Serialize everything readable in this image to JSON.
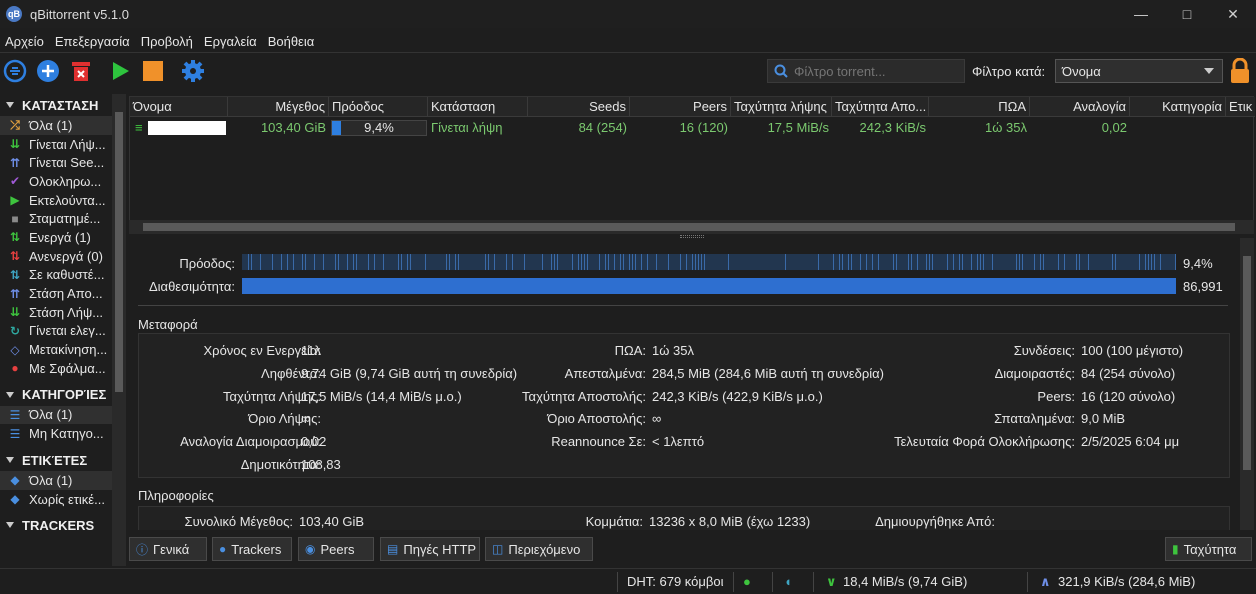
{
  "window": {
    "title": "qBittorrent v5.1.0",
    "app_icon_text": "qB"
  },
  "menu": [
    "Αρχείο",
    "Επεξεργασία",
    "Προβολή",
    "Εργαλεία",
    "Βοήθεια"
  ],
  "toolbar": {
    "search_placeholder": "Φίλτρο torrent...",
    "filter_label": "Φίλτρο κατά:",
    "filter_value": "Όνομα"
  },
  "sidebar": {
    "status_title": "ΚΑΤΆΣΤΑΣΗ",
    "status_items": [
      {
        "label": "Όλα (1)",
        "icon": "shuffle-icon",
        "color": "#e2a03f"
      },
      {
        "label": "Γίνεται Λήψ...",
        "icon": "download-icon",
        "color": "#3ec43e"
      },
      {
        "label": "Γίνεται See...",
        "icon": "upload-icon",
        "color": "#6f8fe8"
      },
      {
        "label": "Ολοκληρω...",
        "icon": "check-icon",
        "color": "#a05ad6"
      },
      {
        "label": "Εκτελούντα...",
        "icon": "play-icon",
        "color": "#3ec43e"
      },
      {
        "label": "Σταματημέ...",
        "icon": "stop-icon",
        "color": "#8a8a8a"
      },
      {
        "label": "Ενεργά (1)",
        "icon": "updown-icon",
        "color": "#3ec43e"
      },
      {
        "label": "Ανενεργά (0)",
        "icon": "updown-icon",
        "color": "#e84040"
      },
      {
        "label": "Σε καθυστέ...",
        "icon": "updown-icon",
        "color": "#3fa6c4"
      },
      {
        "label": "Στάση Απο...",
        "icon": "upload-icon",
        "color": "#6f8fe8"
      },
      {
        "label": "Στάση Λήψ...",
        "icon": "download-icon",
        "color": "#3ec43e"
      },
      {
        "label": "Γίνεται ελεγ...",
        "icon": "refresh-icon",
        "color": "#2fa8a0"
      },
      {
        "label": "Μετακίνηση...",
        "icon": "move-icon",
        "color": "#6f8fe8"
      },
      {
        "label": "Με Σφάλμα...",
        "icon": "error-icon",
        "color": "#e84040"
      }
    ],
    "categories_title": "ΚΑΤΗΓΟΡΊΕΣ",
    "category_items": [
      "Όλα (1)",
      "Μη Κατηγο..."
    ],
    "tags_title": "ΕΤΙΚΈΤΕΣ",
    "tag_items": [
      "Όλα (1)",
      "Χωρίς ετικέ..."
    ],
    "trackers_title": "TRACKERS"
  },
  "torrent_list": {
    "columns": [
      "Όνομα",
      "Μέγεθος",
      "Πρόοδος",
      "Κατάσταση",
      "Seeds",
      "Peers",
      "Ταχύτητα λήψης",
      "Ταχύτητα Απο...",
      "ΠΩΑ",
      "Αναλογία",
      "Κατηγορία",
      "Ετικ"
    ],
    "rows": [
      {
        "size": "103,40 GiB",
        "progress": 0.094,
        "progress_text": "9,4%",
        "status": "Γίνεται λήψη",
        "seeds": "84 (254)",
        "peers": "16 (120)",
        "down": "17,5 MiB/s",
        "up": "242,3 KiB/s",
        "eta": "1ώ 35λ",
        "ratio": "0,02"
      }
    ]
  },
  "details": {
    "progress_label": "Πρόοδος:",
    "progress_value": "9,4%",
    "availability_label": "Διαθεσιμότητα:",
    "availability_value": "86,991",
    "transfer_title": "Μεταφορά",
    "transfer": {
      "col1": [
        {
          "k": "Χρόνος εν Ενεργεία:",
          "v": "11λ"
        },
        {
          "k": "Ληφθέντα:",
          "v": "9,74 GiB (9,74 GiB αυτή τη συνεδρία)"
        },
        {
          "k": "Ταχύτητα Λήψης:",
          "v": "17,5 MiB/s (14,4 MiB/s μ.ο.)"
        },
        {
          "k": "Όριο Λήψης:",
          "v": "∞"
        },
        {
          "k": "Αναλογία Διαμοιρασμού:",
          "v": "0,02"
        },
        {
          "k": "Δημοτικότητα:",
          "v": "108,83"
        }
      ],
      "col2": [
        {
          "k": "ΠΩΑ:",
          "v": "1ώ 35λ"
        },
        {
          "k": "Απεσταλμένα:",
          "v": "284,5 MiB (284,6 MiB αυτή τη συνεδρία)"
        },
        {
          "k": "Ταχύτητα Αποστολής:",
          "v": "242,3 KiB/s (422,9 KiB/s μ.ο.)"
        },
        {
          "k": "Όριο Αποστολής:",
          "v": "∞"
        },
        {
          "k": "Reannounce Σε:",
          "v": "< 1λεπτό"
        }
      ],
      "col3": [
        {
          "k": "Συνδέσεις:",
          "v": "100 (100 μέγιστο)"
        },
        {
          "k": "Διαμοιραστές:",
          "v": "84 (254 σύνολο)"
        },
        {
          "k": "Peers:",
          "v": "16 (120 σύνολο)"
        },
        {
          "k": "Σπαταλημένα:",
          "v": "9,0 MiB"
        },
        {
          "k": "Τελευταία Φορά Ολοκλήρωσης:",
          "v": "2/5/2025 6:04 μμ"
        }
      ]
    },
    "info_title": "Πληροφορίες",
    "info": {
      "total_size_label": "Συνολικό Μέγεθος:",
      "total_size": "103,40 GiB",
      "pieces_label": "Κομμάτια:",
      "pieces": "13236 x 8,0 MiB (έχω 1233)",
      "created_by_label": "Δημιουργήθηκε Από:"
    }
  },
  "tabs": [
    "Γενικά",
    "Trackers",
    "Peers",
    "Πηγές HTTP",
    "Περιεχόμενο"
  ],
  "speed_button": "Ταχύτητα",
  "statusbar": {
    "dht": "DHT: 679 κόμβοι",
    "down": "18,4 MiB/s (9,74 GiB)",
    "up": "321,9 KiB/s (284,6 MiB)"
  },
  "colors": {
    "accent": "#2e6fd0",
    "green": "#7bc96f",
    "orange": "#f0912a",
    "red": "#e84040"
  }
}
